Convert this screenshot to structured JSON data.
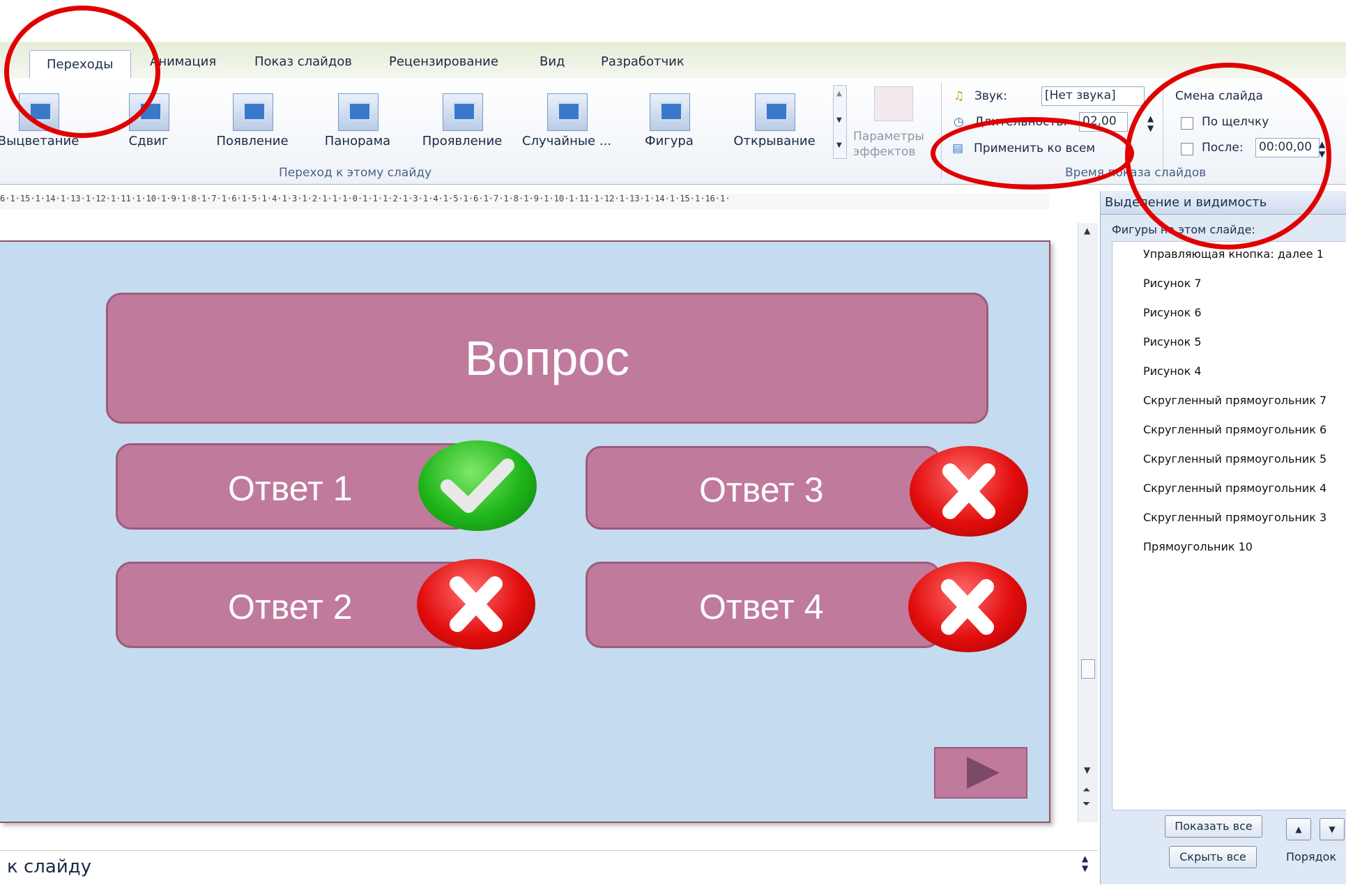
{
  "tabs": [
    {
      "label": "Переходы",
      "active": true
    },
    {
      "label": "Анимация"
    },
    {
      "label": "Показ слайдов"
    },
    {
      "label": "Рецензирование"
    },
    {
      "label": "Вид"
    },
    {
      "label": "Разработчик"
    }
  ],
  "gallery": [
    {
      "label": "Выцветание",
      "icon": "fade-transition-icon"
    },
    {
      "label": "Сдвиг",
      "icon": "push-transition-icon"
    },
    {
      "label": "Появление",
      "icon": "appear-transition-icon"
    },
    {
      "label": "Панорама",
      "icon": "pan-transition-icon"
    },
    {
      "label": "Проявление",
      "icon": "reveal-transition-icon"
    },
    {
      "label": "Случайные ...",
      "icon": "random-bars-transition-icon"
    },
    {
      "label": "Фигура",
      "icon": "shape-transition-icon"
    },
    {
      "label": "Открывание",
      "icon": "uncover-transition-icon"
    }
  ],
  "effects": {
    "line1": "Параметры",
    "line2": "эффектов"
  },
  "group_transition_label": "Переход к этому слайду",
  "timing": {
    "sound_label": "Звук:",
    "sound_value": "[Нет звука]",
    "duration_label": "Длительность:",
    "duration_value": "02,00",
    "apply_all": "Применить ко всем",
    "advance_title": "Смена слайда",
    "on_click": "По щелчку",
    "after_label": "После:",
    "after_value": "00:00,00",
    "group_label": "Время показа слайдов"
  },
  "ruler_text": "6·1·15·1·14·1·13·1·12·1·11·1·10·1·9·1·8·1·7·1·6·1·5·1·4·1·3·1·2·1·1·1·0·1·1·1·2·1·3·1·4·1·5·1·6·1·7·1·8·1·9·1·10·1·11·1·12·1·13·1·14·1·15·1·16·1·",
  "slide": {
    "question": "Вопрос",
    "answers": [
      {
        "label": "Ответ 1",
        "mark": "correct"
      },
      {
        "label": "Ответ 2",
        "mark": "wrong"
      },
      {
        "label": "Ответ 3",
        "mark": "wrong"
      },
      {
        "label": "Ответ 4",
        "mark": "wrong"
      }
    ]
  },
  "pane": {
    "title": "Выделение и видимость",
    "subtitle": "Фигуры на этом слайде:",
    "items": [
      "Управляющая кнопка: далее 1",
      "Рисунок 7",
      "Рисунок 6",
      "Рисунок 5",
      "Рисунок 4",
      "Скругленный прямоугольник 7",
      "Скругленный прямоугольник 6",
      "Скругленный прямоугольник 5",
      "Скругленный прямоугольник 4",
      "Скругленный прямоугольник 3",
      "Прямоугольник 10"
    ],
    "show_all": "Показать все",
    "hide_all": "Скрыть все",
    "order_label": "Порядок"
  },
  "notes_text": "к слайду",
  "colors": {
    "annotation": "#e00000",
    "slide_bg": "#c5dbef",
    "button_fill": "#c07a9c"
  }
}
